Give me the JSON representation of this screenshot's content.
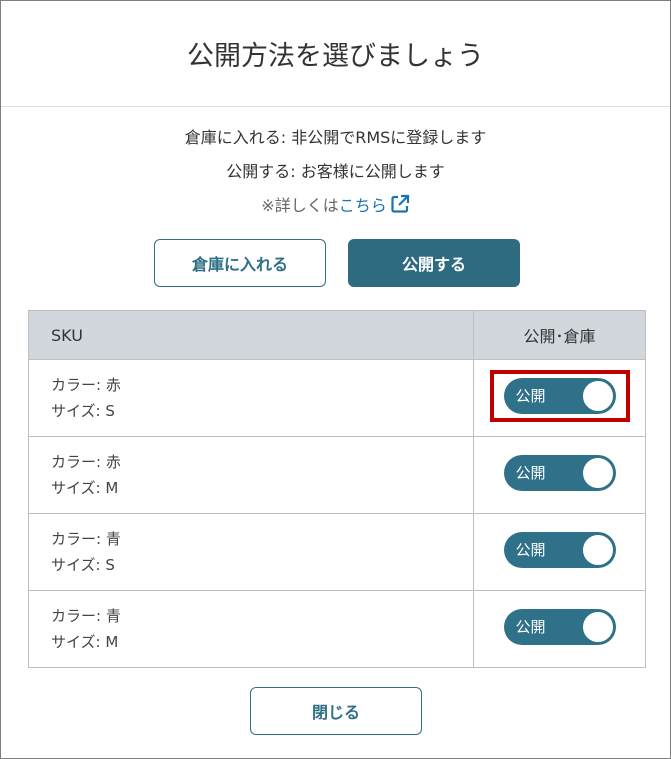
{
  "dialog": {
    "title": "公開方法を選びましょう",
    "description": {
      "line1": "倉庫に入れる: 非公開でRMSに登録します",
      "line2": "公開する: お客様に公開します",
      "note_prefix": "※詳しくは",
      "note_link": "こちら"
    },
    "buttons": {
      "warehouse": "倉庫に入れる",
      "publish": "公開する",
      "close": "閉じる"
    },
    "table": {
      "headers": [
        "SKU",
        "公開･倉庫"
      ],
      "rows": [
        {
          "color": "カラー: 赤",
          "size": "サイズ: S",
          "status": "公開"
        },
        {
          "color": "カラー: 赤",
          "size": "サイズ: M",
          "status": "公開"
        },
        {
          "color": "カラー: 青",
          "size": "サイズ: S",
          "status": "公開"
        },
        {
          "color": "カラー: 青",
          "size": "サイズ: M",
          "status": "公開"
        }
      ]
    }
  },
  "colors": {
    "primary": "#2e6b80",
    "toggle_on": "#2e7189",
    "link": "#1a73b8",
    "highlight": "#c00000",
    "header_bg": "#d2d7dd"
  },
  "icons": {
    "note_link": "external-link-icon"
  }
}
